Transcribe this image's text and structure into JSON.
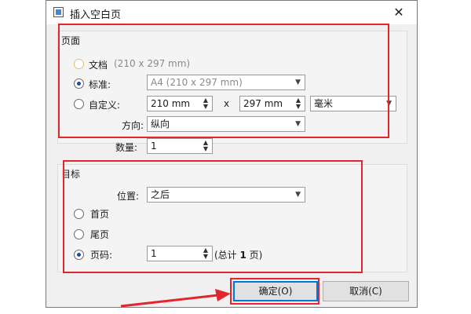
{
  "window": {
    "title": "插入空白页",
    "close": "✕"
  },
  "page_group": {
    "title": "页面",
    "document_option": {
      "label": "文档",
      "detail": "(210 x 297 mm)"
    },
    "standard_option": {
      "label": "标准:",
      "value": "A4 (210 x 297 mm)"
    },
    "custom_option": {
      "label": "自定义:",
      "width": "210 mm",
      "times": "x",
      "height": "297 mm",
      "unit": "毫米"
    },
    "orientation": {
      "label": "方向:",
      "value": "纵向"
    },
    "count": {
      "label": "数量:",
      "value": "1"
    }
  },
  "target_group": {
    "title": "目标",
    "position": {
      "label": "位置:",
      "value": "之后"
    },
    "first_page": "首页",
    "last_page": "尾页",
    "page_number": {
      "label": "页码:",
      "value": "1",
      "total_prefix": "(总计 ",
      "total_number": "1",
      "total_suffix": " 页)"
    }
  },
  "buttons": {
    "ok": "确定(O)",
    "cancel": "取消(C)"
  },
  "colors": {
    "highlight": "#e3262e",
    "accent": "#0078d7",
    "radio_selected": "#1f4f9c"
  }
}
